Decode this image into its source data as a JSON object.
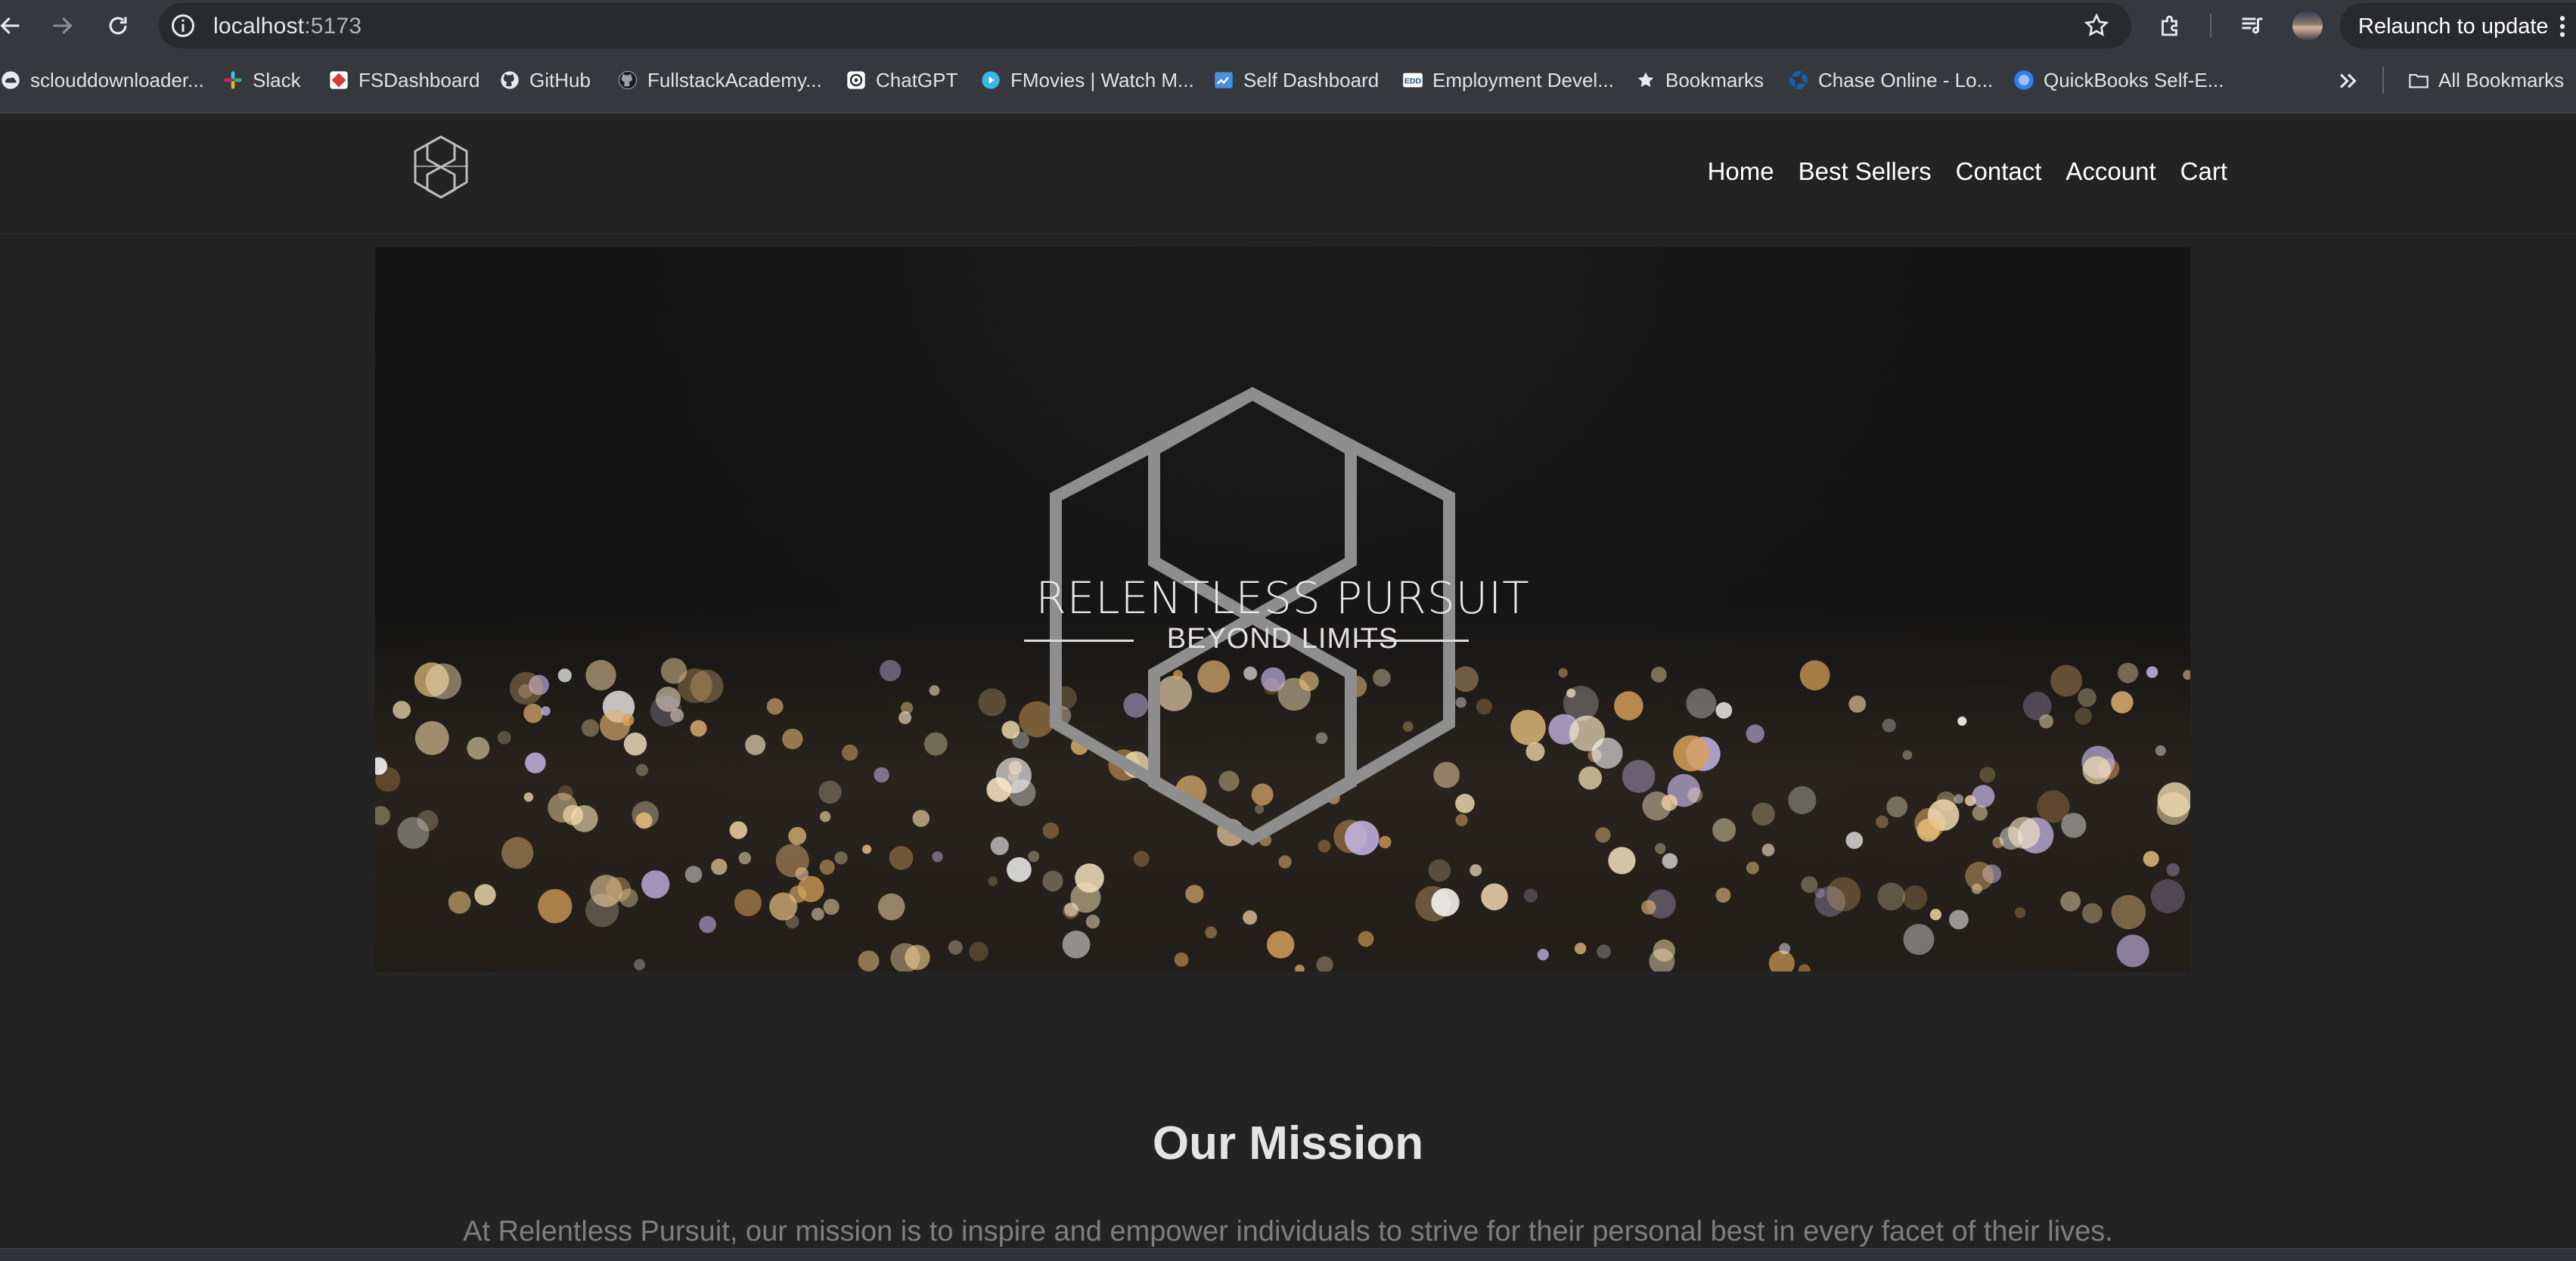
{
  "browser": {
    "url_host": "localhost",
    "url_port": ":5173",
    "relaunch_label": "Relaunch to update",
    "bookmarks": [
      {
        "label": "sclouddownloader...",
        "icon": "soundcloud-icon"
      },
      {
        "label": "Slack",
        "icon": "slack-icon"
      },
      {
        "label": "FSDashboard",
        "icon": "fsdashboard-icon"
      },
      {
        "label": "GitHub",
        "icon": "github-icon"
      },
      {
        "label": "FullstackAcademy...",
        "icon": "github-icon"
      },
      {
        "label": "ChatGPT",
        "icon": "chatgpt-icon"
      },
      {
        "label": "FMovies | Watch M...",
        "icon": "play-icon"
      },
      {
        "label": "Self Dashboard",
        "icon": "dashboard-icon"
      },
      {
        "label": "Employment Devel...",
        "icon": "edd-icon"
      },
      {
        "label": "Bookmarks",
        "icon": "star-icon"
      },
      {
        "label": "Chase Online - Lo...",
        "icon": "chase-icon"
      },
      {
        "label": "QuickBooks Self-E...",
        "icon": "quickbooks-icon"
      }
    ],
    "all_bookmarks_label": "All Bookmarks"
  },
  "site": {
    "nav": [
      {
        "label": "Home"
      },
      {
        "label": "Best Sellers"
      },
      {
        "label": "Contact"
      },
      {
        "label": "Account"
      },
      {
        "label": "Cart"
      }
    ],
    "hero": {
      "title": "RELENTLESS PURSUIT",
      "subtitle": "BEYOND LIMITS"
    },
    "mission": {
      "title": "Our Mission",
      "text": "At Relentless Pursuit, our mission is to inspire and empower individuals to strive for their personal best in every facet of their lives."
    }
  }
}
